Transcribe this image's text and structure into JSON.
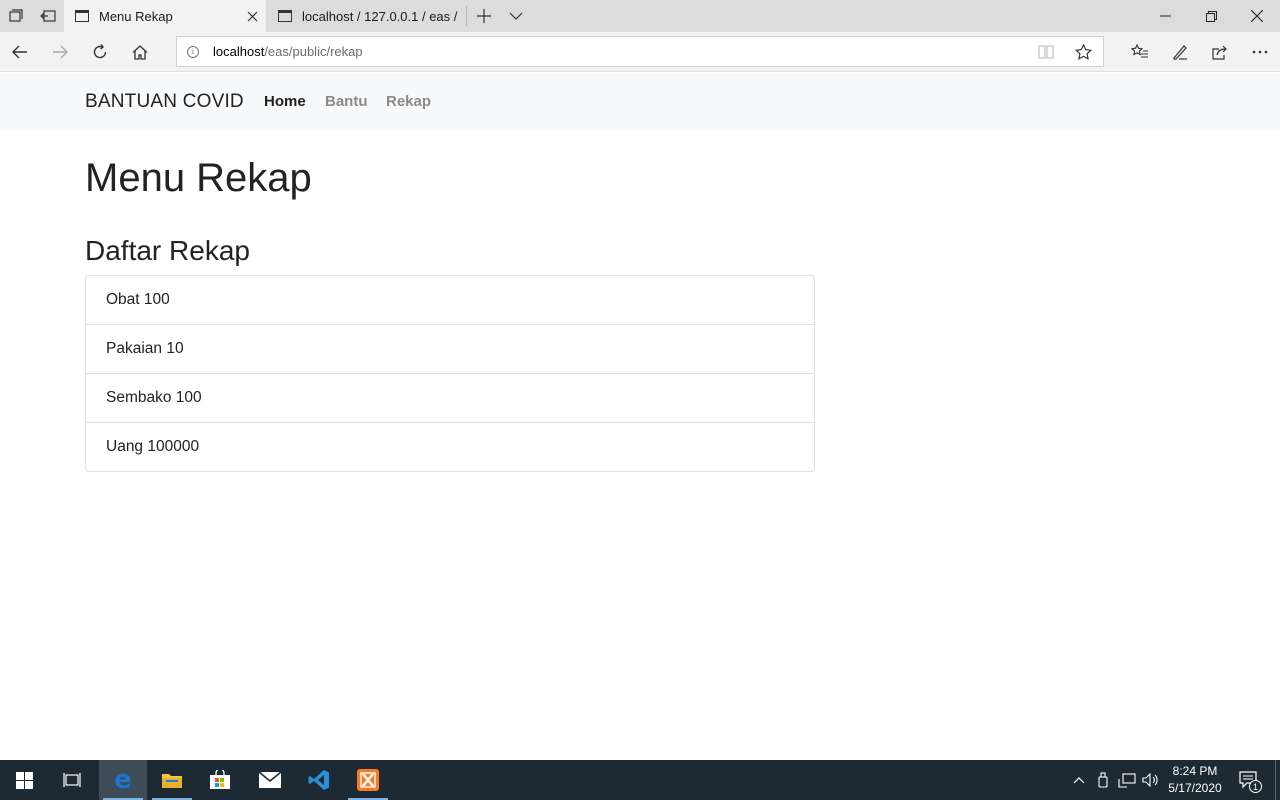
{
  "browser": {
    "tabs": [
      {
        "title": "Menu Rekap",
        "active": true
      },
      {
        "title": "localhost / 127.0.0.1 / eas /",
        "active": false
      }
    ],
    "address": {
      "host": "localhost",
      "path": "/eas/public/rekap"
    }
  },
  "page": {
    "brand": "BANTUAN COVID",
    "nav": [
      {
        "label": "Home",
        "active": true
      },
      {
        "label": "Bantu",
        "active": false
      },
      {
        "label": "Rekap",
        "active": false
      }
    ],
    "title": "Menu Rekap",
    "subtitle": "Daftar Rekap",
    "items": [
      "Obat 100",
      "Pakaian 10",
      "Sembako 100",
      "Uang 100000"
    ]
  },
  "taskbar": {
    "time": "8:24 PM",
    "date": "5/17/2020",
    "notification_count": "1"
  },
  "colors": {
    "taskbar_bg": "#1d2a33",
    "edge_blue": "#1e74d3",
    "nav_bg": "#f8f9fa"
  }
}
